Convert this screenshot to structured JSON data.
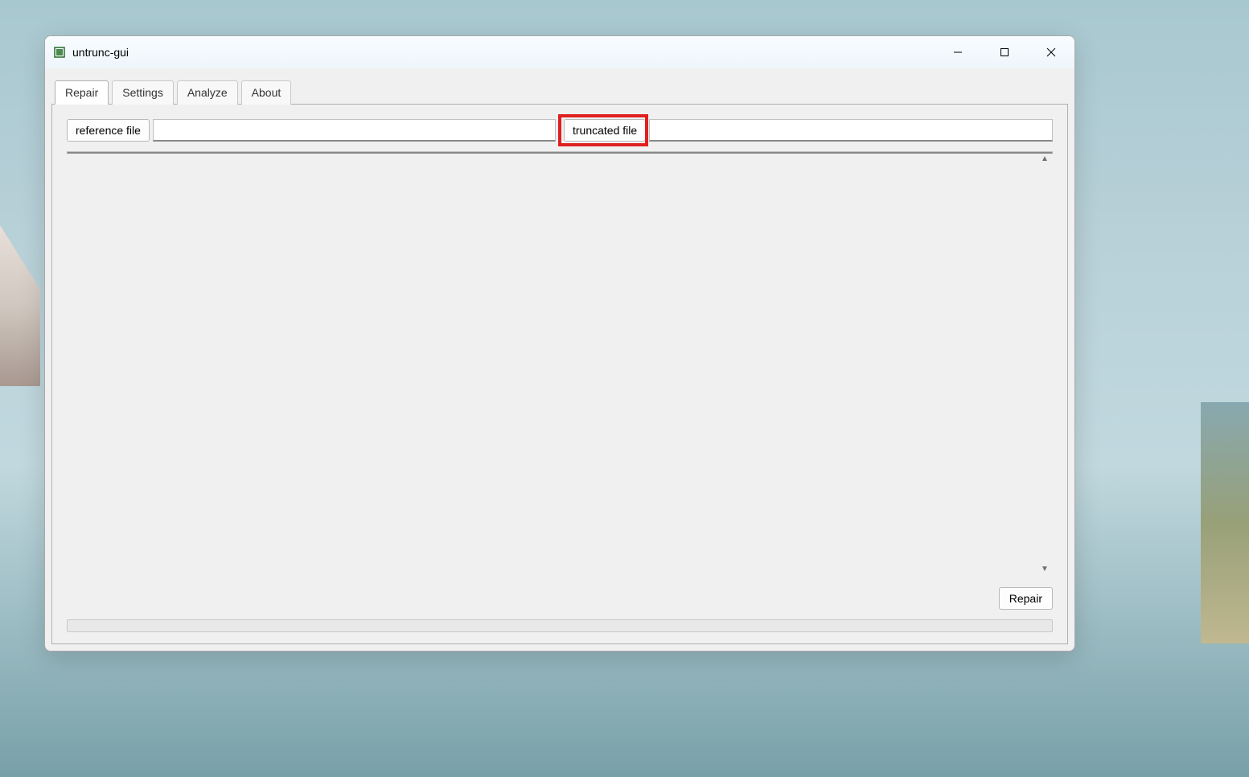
{
  "window": {
    "title": "untrunc-gui"
  },
  "tabs": [
    {
      "label": "Repair",
      "active": true
    },
    {
      "label": "Settings",
      "active": false
    },
    {
      "label": "Analyze",
      "active": false
    },
    {
      "label": "About",
      "active": false
    }
  ],
  "buttons": {
    "reference_file": "reference file",
    "truncated_file": "truncated file",
    "repair": "Repair"
  },
  "inputs": {
    "reference_file_value": "",
    "truncated_file_value": ""
  },
  "output_text": "",
  "highlight": {
    "target": "truncated_file_button"
  }
}
